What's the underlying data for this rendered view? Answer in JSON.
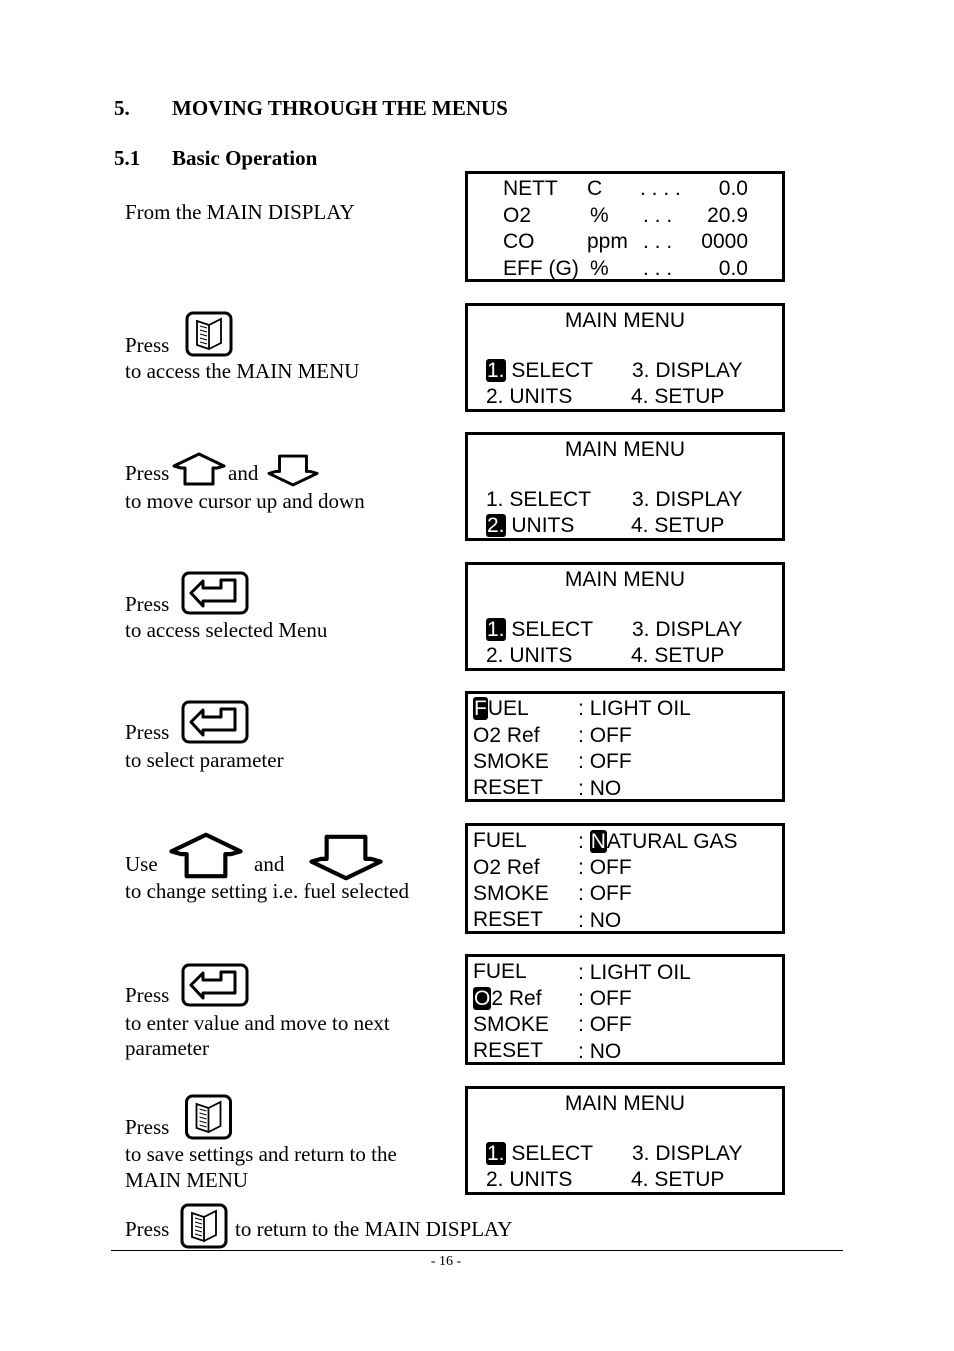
{
  "heading": {
    "number": "5.",
    "title": "MOVING THROUGH THE MENUS"
  },
  "subheading": {
    "number": "5.1",
    "title": "Basic Operation"
  },
  "steps": {
    "s0": "From the MAIN DISPLAY",
    "s1a": "Press",
    "s1b": "to access the MAIN MENU",
    "s2a": "Press",
    "s2and": "and",
    "s2b": "to move cursor up and down",
    "s3a": "Press",
    "s3b": "to access selected Menu",
    "s4a": "Press",
    "s4b": "to select parameter",
    "s5a": "Use",
    "s5and": "and",
    "s5b": "to change setting i.e. fuel selected",
    "s6a": "Press",
    "s6b": "to enter value and move to next",
    "s6c": "parameter",
    "s7a": "Press",
    "s7b": "to save settings and return to the",
    "s7c": "MAIN MENU",
    "s8a": "Press",
    "s8b": "to return to the MAIN DISPLAY"
  },
  "icons": {
    "menu": "book-menu-key-icon",
    "up": "up-arrow-key-icon",
    "down": "down-arrow-key-icon",
    "enter": "enter-key-icon"
  },
  "main_display": [
    {
      "label": "NETT",
      "unit": "C",
      "dots": ". . . .",
      "value": "0.0"
    },
    {
      "label": "O2",
      "unit": "%",
      "dots": ". . .",
      "value": "20.9"
    },
    {
      "label": "CO",
      "unit": "ppm",
      "dots": ". . .",
      "value": "0000"
    },
    {
      "label": "EFF (G)",
      "unit": "%",
      "dots": ". . .",
      "value": "0.0"
    }
  ],
  "menu": {
    "title": "MAIN MENU",
    "i1": "SELECT",
    "i2": "UNITS",
    "i3": "3. DISPLAY",
    "i4": "4. SETUP",
    "n1": "1.",
    "n2": "2."
  },
  "params": {
    "fuel": "FUEL",
    "fuel_cur": "F",
    "fuel_rest": "UEL",
    "o2": "O2 Ref",
    "o2_cur": "O",
    "o2_rest": "2 Ref",
    "smoke": "SMOKE",
    "reset": "RESET",
    "colon": ":",
    "light_oil": "LIGHT OIL",
    "nat_cur": "N",
    "nat_rest": "ATURAL GAS",
    "off": "OFF",
    "no": "NO"
  },
  "page_number": "- 16 -"
}
